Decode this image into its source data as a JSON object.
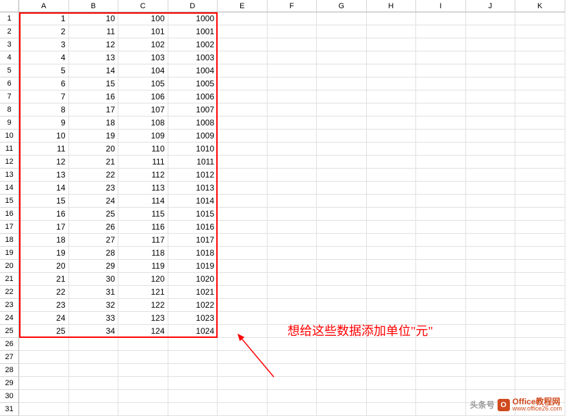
{
  "columns": [
    "A",
    "B",
    "C",
    "D",
    "E",
    "F",
    "G",
    "H",
    "I",
    "J",
    "K"
  ],
  "rowCount": 31,
  "dataRows": 25,
  "cells": {
    "A": [
      1,
      2,
      3,
      4,
      5,
      6,
      7,
      8,
      9,
      10,
      11,
      12,
      13,
      14,
      15,
      16,
      17,
      18,
      19,
      20,
      21,
      22,
      23,
      24,
      25
    ],
    "B": [
      10,
      11,
      12,
      13,
      14,
      15,
      16,
      17,
      18,
      19,
      20,
      21,
      22,
      23,
      24,
      25,
      26,
      27,
      28,
      29,
      30,
      31,
      32,
      33,
      34
    ],
    "C": [
      100,
      101,
      102,
      103,
      104,
      105,
      106,
      107,
      108,
      109,
      110,
      111,
      112,
      113,
      114,
      115,
      116,
      117,
      118,
      119,
      120,
      121,
      122,
      123,
      124
    ],
    "D": [
      1000,
      1001,
      1002,
      1003,
      1004,
      1005,
      1006,
      1007,
      1008,
      1009,
      1010,
      1011,
      1012,
      1013,
      1014,
      1015,
      1016,
      1017,
      1018,
      1019,
      1020,
      1021,
      1022,
      1023,
      1024
    ]
  },
  "annotation": "想给这些数据添加单位\"元\"",
  "watermark": {
    "toutiao": "头条号",
    "iconLetter": "O",
    "line1": "Office教程网",
    "line2": "www.office26.com"
  }
}
